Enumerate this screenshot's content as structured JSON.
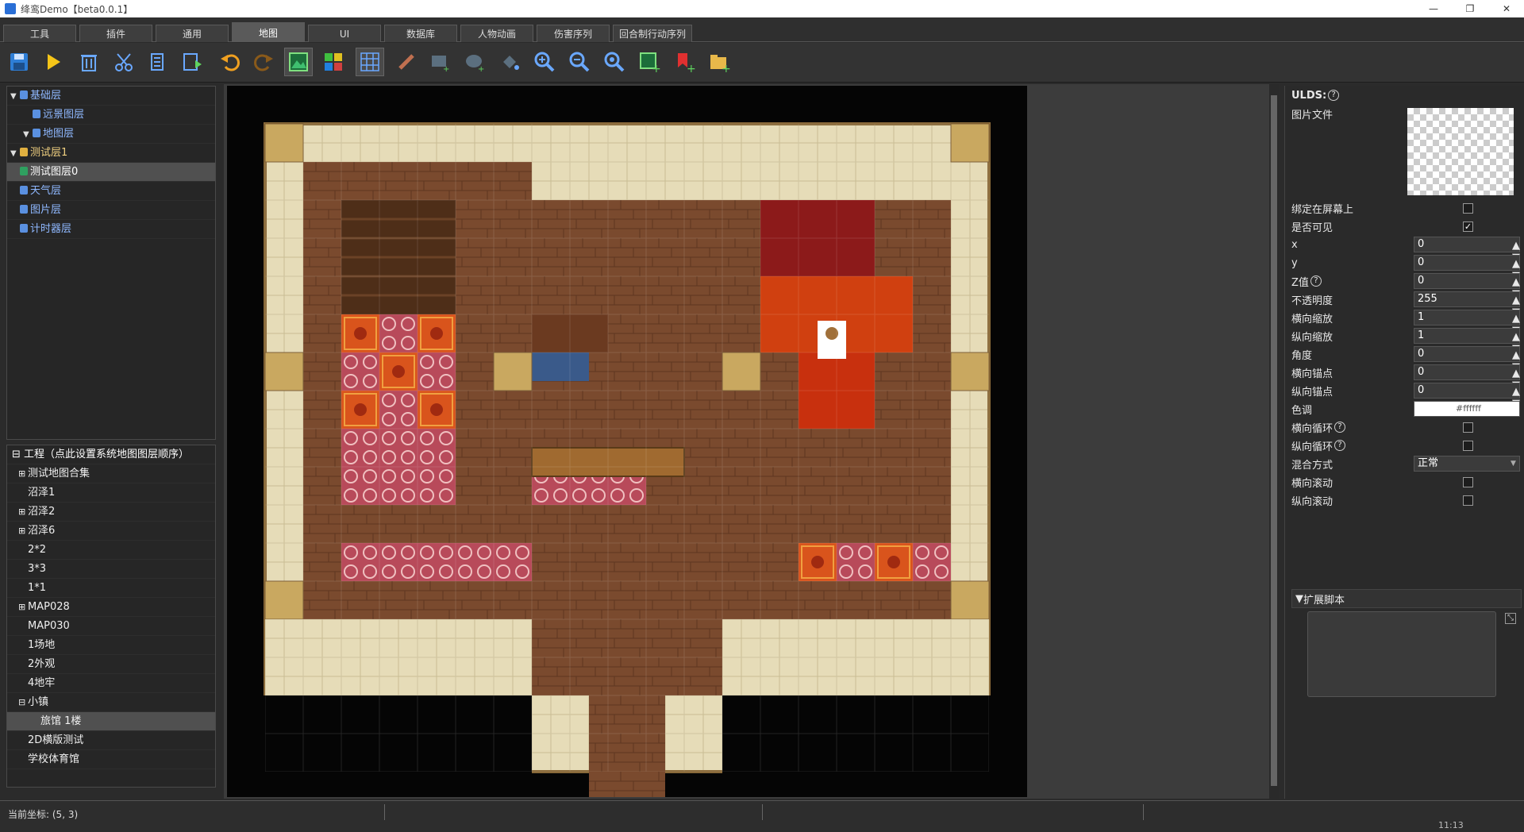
{
  "window": {
    "title": "绛鸾Demo【beta0.0.1】",
    "minimize": "—",
    "restore": "❐",
    "close": "✕"
  },
  "tabs": [
    {
      "label": "工具"
    },
    {
      "label": "插件"
    },
    {
      "label": "通用"
    },
    {
      "label": "地图",
      "active": true
    },
    {
      "label": "UI"
    },
    {
      "label": "数据库"
    },
    {
      "label": "人物动画"
    },
    {
      "label": "伤害序列"
    },
    {
      "label": "回合制行动序列"
    }
  ],
  "toolbar": {
    "buttons": [
      "save-icon",
      "play-icon",
      "delete-icon",
      "cut-icon",
      "copy-icon",
      "paste-icon",
      "undo-icon",
      "redo-icon",
      "map-view-icon",
      "region-icon",
      "grid-icon",
      "pencil-icon",
      "rect-icon",
      "ellipse-icon",
      "fill-icon",
      "zoom-in-icon",
      "zoom-out-icon",
      "zoom-reset-icon",
      "add-map-icon",
      "add-event-icon",
      "open-folder-icon"
    ]
  },
  "layers": {
    "items": [
      {
        "label": "基础层",
        "indent": 0,
        "expand": "▼",
        "kind": "blue"
      },
      {
        "label": "远景图层",
        "indent": 1,
        "expand": "",
        "kind": "blue"
      },
      {
        "label": "地图层",
        "indent": 1,
        "expand": "▼",
        "kind": "blue"
      },
      {
        "label": "测试层1",
        "indent": 0,
        "expand": "▼",
        "kind": "gold"
      },
      {
        "label": "测试图层0",
        "indent": 0,
        "expand": "",
        "kind": "map",
        "selected": true
      },
      {
        "label": "天气层",
        "indent": 0,
        "expand": "",
        "kind": "blue"
      },
      {
        "label": "图片层",
        "indent": 0,
        "expand": "",
        "kind": "blue"
      },
      {
        "label": "计时器层",
        "indent": 0,
        "expand": "",
        "kind": "blue"
      }
    ]
  },
  "project": {
    "header": "工程（点此设置系统地图图层顺序）",
    "items": [
      {
        "label": "测试地图合集",
        "expand": "⊞"
      },
      {
        "label": "沼泽1",
        "expand": ""
      },
      {
        "label": "沼泽2",
        "expand": "⊞"
      },
      {
        "label": "沼泽6",
        "expand": "⊞"
      },
      {
        "label": "2*2",
        "expand": ""
      },
      {
        "label": "3*3",
        "expand": ""
      },
      {
        "label": "1*1",
        "expand": ""
      },
      {
        "label": "MAP028",
        "expand": "⊞"
      },
      {
        "label": "MAP030",
        "expand": ""
      },
      {
        "label": "1场地",
        "expand": ""
      },
      {
        "label": "2外观",
        "expand": ""
      },
      {
        "label": "4地牢",
        "expand": ""
      },
      {
        "label": "小镇",
        "expand": "⊟"
      },
      {
        "label": "旅馆 1楼",
        "expand": "",
        "child": true,
        "selected": true
      },
      {
        "label": "2D横版测试",
        "expand": ""
      },
      {
        "label": "学校体育馆",
        "expand": ""
      }
    ]
  },
  "properties": {
    "header": "ULDS:",
    "image_label": "图片文件",
    "rows": [
      {
        "label": "绑定在屏幕上",
        "type": "check",
        "checked": false
      },
      {
        "label": "是否可见",
        "type": "check",
        "checked": true
      },
      {
        "label": "x",
        "type": "num",
        "value": "0"
      },
      {
        "label": "y",
        "type": "num",
        "value": "0"
      },
      {
        "label": "Z值",
        "type": "num",
        "value": "0",
        "help": true
      },
      {
        "label": "不透明度",
        "type": "num",
        "value": "255"
      },
      {
        "label": "横向缩放",
        "type": "num",
        "value": "1"
      },
      {
        "label": "纵向缩放",
        "type": "num",
        "value": "1"
      },
      {
        "label": "角度",
        "type": "num",
        "value": "0"
      },
      {
        "label": "横向锚点",
        "type": "num",
        "value": "0"
      },
      {
        "label": "纵向锚点",
        "type": "num",
        "value": "0"
      },
      {
        "label": "色调",
        "type": "color",
        "value": "#ffffff"
      },
      {
        "label": "横向循环",
        "type": "check",
        "checked": false,
        "help": true
      },
      {
        "label": "纵向循环",
        "type": "check",
        "checked": false,
        "help": true
      },
      {
        "label": "混合方式",
        "type": "select",
        "value": "正常"
      },
      {
        "label": "横向滚动",
        "type": "check",
        "checked": false
      },
      {
        "label": "纵向滚动",
        "type": "check",
        "checked": false
      }
    ],
    "script_section": "扩展脚本"
  },
  "status": {
    "coord_label": "当前坐标:",
    "coord_value": "(5, 3)",
    "right_text": "11:13"
  },
  "colors": {
    "accent": "#2a6fd6",
    "floor": "#7a4a2e",
    "carpet": "#c8461a",
    "wall": "#d9cfa8"
  }
}
